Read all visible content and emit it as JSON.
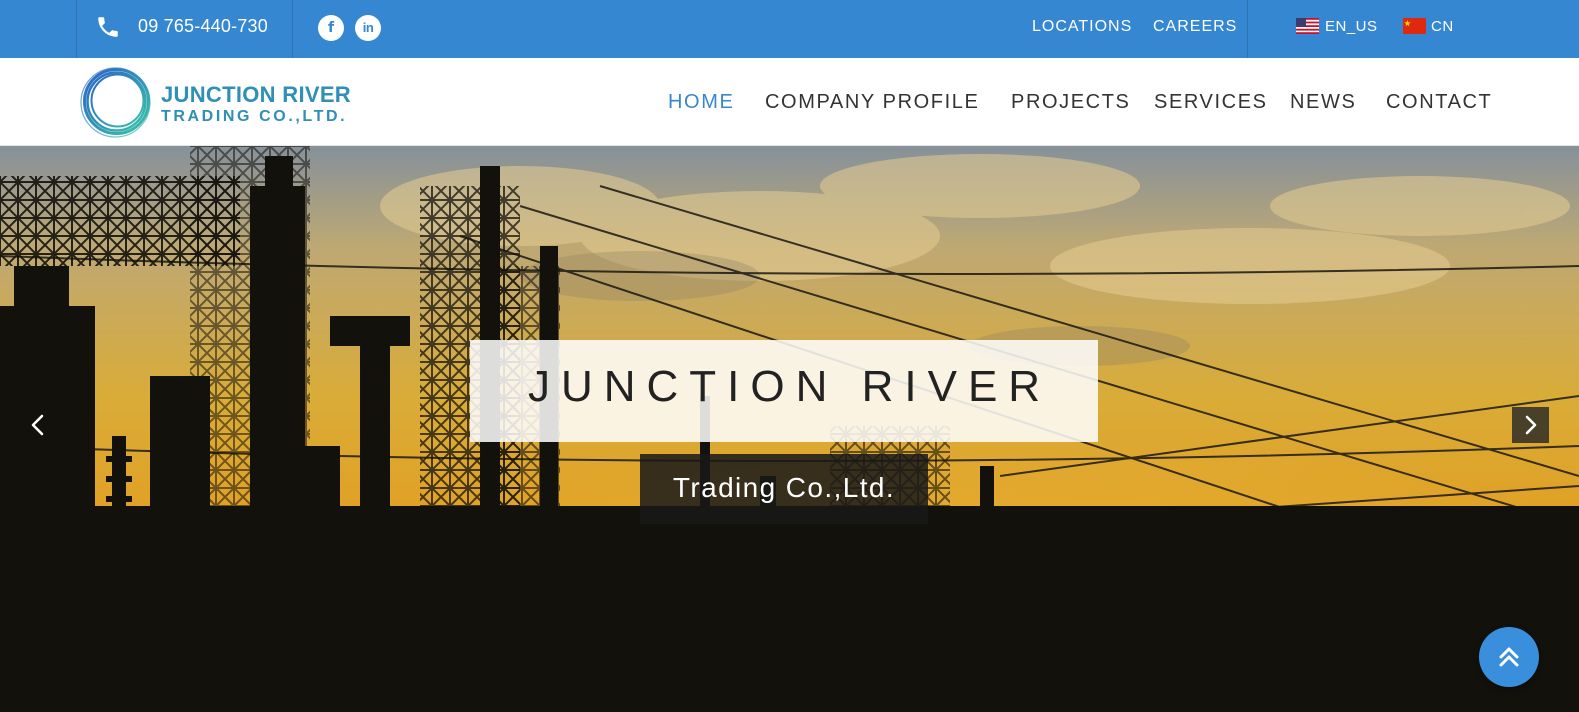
{
  "topbar": {
    "phone": "09 765-440-730",
    "social": {
      "facebook_label": "f",
      "linkedin_label": "in"
    },
    "links": {
      "locations": "LOCATIONS",
      "careers": "CAREERS"
    },
    "languages": {
      "en": "EN_US",
      "cn": "CN"
    },
    "icons": [
      "phone-icon",
      "facebook-icon",
      "linkedin-icon",
      "us-flag-icon",
      "cn-flag-icon"
    ],
    "bg_color": "#3587d1"
  },
  "header": {
    "logo": {
      "line1": "JUNCTION RIVER",
      "line2": "TRADING CO.,LTD."
    },
    "nav": [
      {
        "label": "HOME",
        "active": true
      },
      {
        "label": "COMPANY PROFILE",
        "active": false
      },
      {
        "label": "PROJECTS",
        "active": false
      },
      {
        "label": "SERVICES",
        "active": false
      },
      {
        "label": "NEWS",
        "active": false
      },
      {
        "label": "CONTACT",
        "active": false
      }
    ],
    "accent_color": "#3a87c8"
  },
  "hero": {
    "title": "JUNCTION RIVER",
    "subtitle": "Trading Co.,Ltd.",
    "icons": [
      "chevron-left-icon",
      "chevron-right-icon",
      "double-chevron-up-icon"
    ]
  }
}
